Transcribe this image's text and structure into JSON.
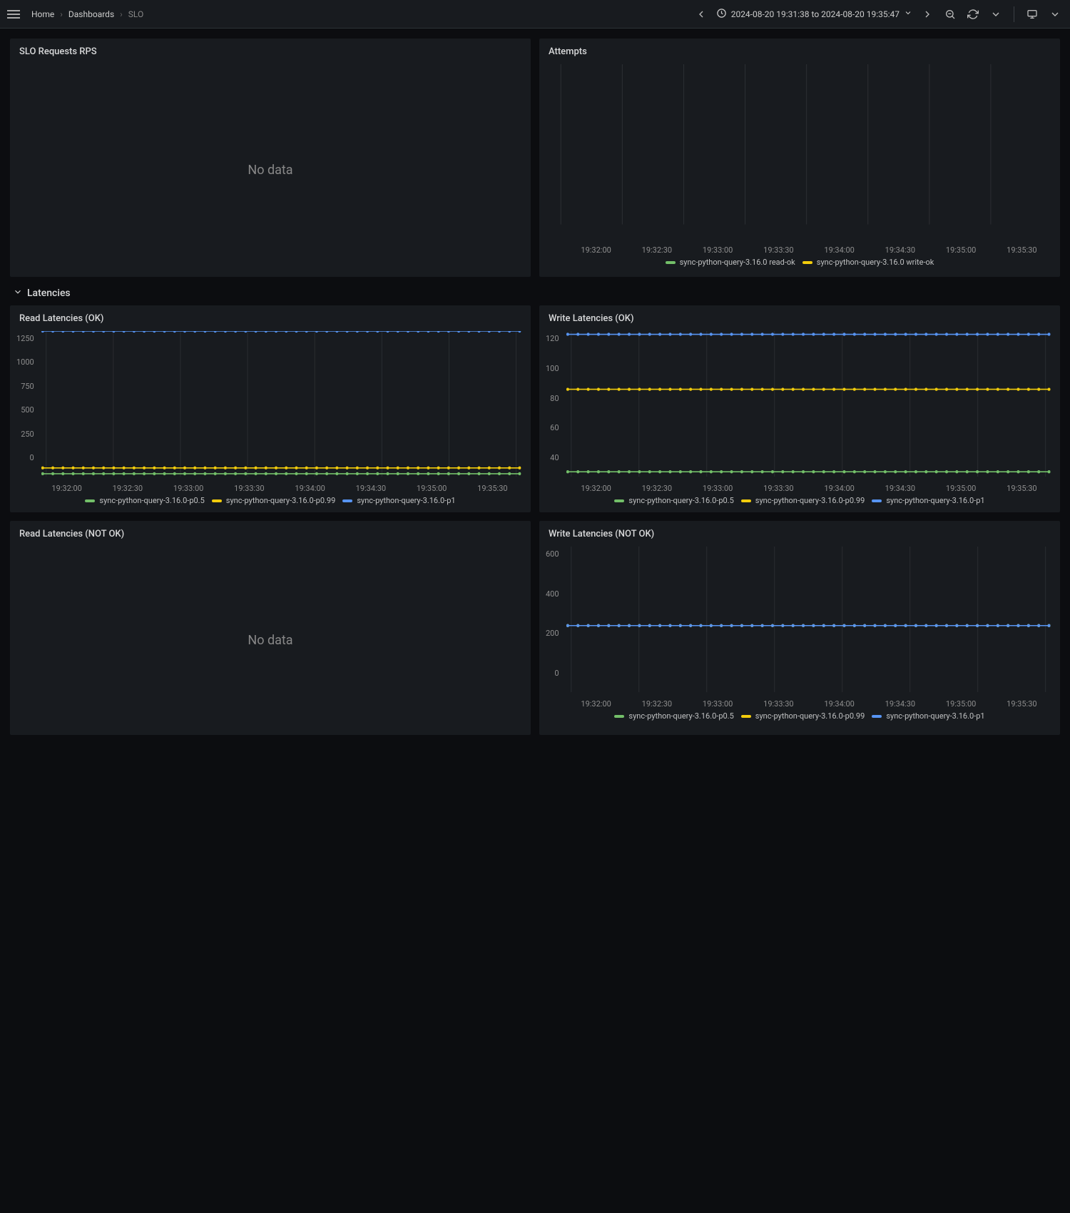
{
  "breadcrumbs": [
    "Home",
    "Dashboards",
    "SLO"
  ],
  "timerange": "2024-08-20 19:31:38 to 2024-08-20 19:35:47",
  "no_data": "No data",
  "section": {
    "latencies": "Latencies"
  },
  "panels": {
    "slo_requests": {
      "title": "SLO Requests RPS"
    },
    "attempts": {
      "title": "Attempts"
    },
    "read_ok": {
      "title": "Read Latencies (OK)"
    },
    "write_ok": {
      "title": "Write Latencies (OK)"
    },
    "read_nok": {
      "title": "Read Latencies (NOT OK)"
    },
    "write_nok": {
      "title": "Write Latencies (NOT OK)"
    }
  },
  "chart_data": [
    {
      "id": "attempts",
      "type": "line",
      "title": "Attempts",
      "x_ticks": [
        "19:32:00",
        "19:32:30",
        "19:33:00",
        "19:33:30",
        "19:34:00",
        "19:34:30",
        "19:35:00",
        "19:35:30"
      ],
      "series": [
        {
          "name": "sync-python-query-3.16.0 read-ok",
          "color": "#73bf69"
        },
        {
          "name": "sync-python-query-3.16.0 write-ok",
          "color": "#f2cc0c"
        }
      ]
    },
    {
      "id": "read_ok",
      "type": "line",
      "title": "Read Latencies (OK)",
      "ylim": [
        0,
        1250
      ],
      "y_ticks": [
        "1250",
        "1000",
        "750",
        "500",
        "250",
        "0"
      ],
      "x_ticks": [
        "19:32:00",
        "19:32:30",
        "19:33:00",
        "19:33:30",
        "19:34:00",
        "19:34:30",
        "19:35:00",
        "19:35:30"
      ],
      "series": [
        {
          "name": "sync-python-query-3.16.0-p0.5",
          "color": "#73bf69",
          "value": 25
        },
        {
          "name": "sync-python-query-3.16.0-p0.99",
          "color": "#f2cc0c",
          "value": 75
        },
        {
          "name": "sync-python-query-3.16.0-p1",
          "color": "#5794f2",
          "value": 1250
        }
      ]
    },
    {
      "id": "write_ok",
      "type": "line",
      "title": "Write Latencies (OK)",
      "ylim": [
        40,
        130
      ],
      "y_ticks": [
        "120",
        "100",
        "80",
        "60",
        "40"
      ],
      "x_ticks": [
        "19:32:00",
        "19:32:30",
        "19:33:00",
        "19:33:30",
        "19:34:00",
        "19:34:30",
        "19:35:00",
        "19:35:30"
      ],
      "series": [
        {
          "name": "sync-python-query-3.16.0-p0.5",
          "color": "#73bf69",
          "value": 43
        },
        {
          "name": "sync-python-query-3.16.0-p0.99",
          "color": "#f2cc0c",
          "value": 94
        },
        {
          "name": "sync-python-query-3.16.0-p1",
          "color": "#5794f2",
          "value": 128
        }
      ]
    },
    {
      "id": "write_nok",
      "type": "line",
      "title": "Write Latencies (NOT OK)",
      "ylim": [
        0,
        700
      ],
      "y_ticks": [
        "600",
        "400",
        "200",
        "0"
      ],
      "x_ticks": [
        "19:32:00",
        "19:32:30",
        "19:33:00",
        "19:33:30",
        "19:34:00",
        "19:34:30",
        "19:35:00",
        "19:35:30"
      ],
      "series": [
        {
          "name": "sync-python-query-3.16.0-p0.5",
          "color": "#73bf69",
          "value": 320
        },
        {
          "name": "sync-python-query-3.16.0-p0.99",
          "color": "#f2cc0c",
          "value": 320
        },
        {
          "name": "sync-python-query-3.16.0-p1",
          "color": "#5794f2",
          "value": 320
        }
      ]
    }
  ]
}
